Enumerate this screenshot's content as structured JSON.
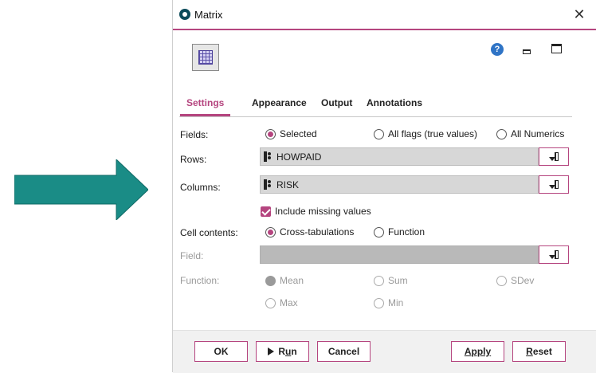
{
  "window": {
    "title": "Matrix"
  },
  "tabs": [
    {
      "label": "Settings",
      "active": true
    },
    {
      "label": "Appearance",
      "active": false
    },
    {
      "label": "Output",
      "active": false
    },
    {
      "label": "Annotations",
      "active": false
    }
  ],
  "fields": {
    "label": "Fields:",
    "options": [
      {
        "label": "Selected",
        "selected": true
      },
      {
        "label": "All flags (true values)",
        "selected": false
      },
      {
        "label": "All Numerics",
        "selected": false
      }
    ]
  },
  "rows": {
    "label": "Rows:",
    "value": "HOWPAID"
  },
  "columns": {
    "label": "Columns:",
    "value": "RISK"
  },
  "include_missing": {
    "label": "Include missing values",
    "checked": true
  },
  "cell_contents": {
    "label": "Cell contents:",
    "options": [
      {
        "label": "Cross-tabulations",
        "selected": true
      },
      {
        "label": "Function",
        "selected": false
      }
    ]
  },
  "field": {
    "label": "Field:",
    "value": "",
    "disabled": true
  },
  "function": {
    "label": "Function:",
    "disabled": true,
    "options": [
      {
        "label": "Mean",
        "selected": true
      },
      {
        "label": "Sum",
        "selected": false
      },
      {
        "label": "SDev",
        "selected": false
      },
      {
        "label": "Max",
        "selected": false
      },
      {
        "label": "Min",
        "selected": false
      }
    ]
  },
  "buttons": {
    "ok": "OK",
    "run_prefix": "R",
    "run_underlined": "u",
    "run_suffix": "n",
    "cancel": "Cancel",
    "apply_prefix": "",
    "apply_underlined": "A",
    "apply_suffix": "pply",
    "reset_prefix": "",
    "reset_underlined": "R",
    "reset_suffix": "eset"
  },
  "colors": {
    "accent": "#b5457f",
    "arrow": "#1a8c86"
  },
  "icons": {
    "app": "spss-modeler-icon",
    "node": "matrix-node-icon",
    "help": "help-icon",
    "field_type": "nominal-field-icon",
    "picker": "field-picker-icon"
  }
}
